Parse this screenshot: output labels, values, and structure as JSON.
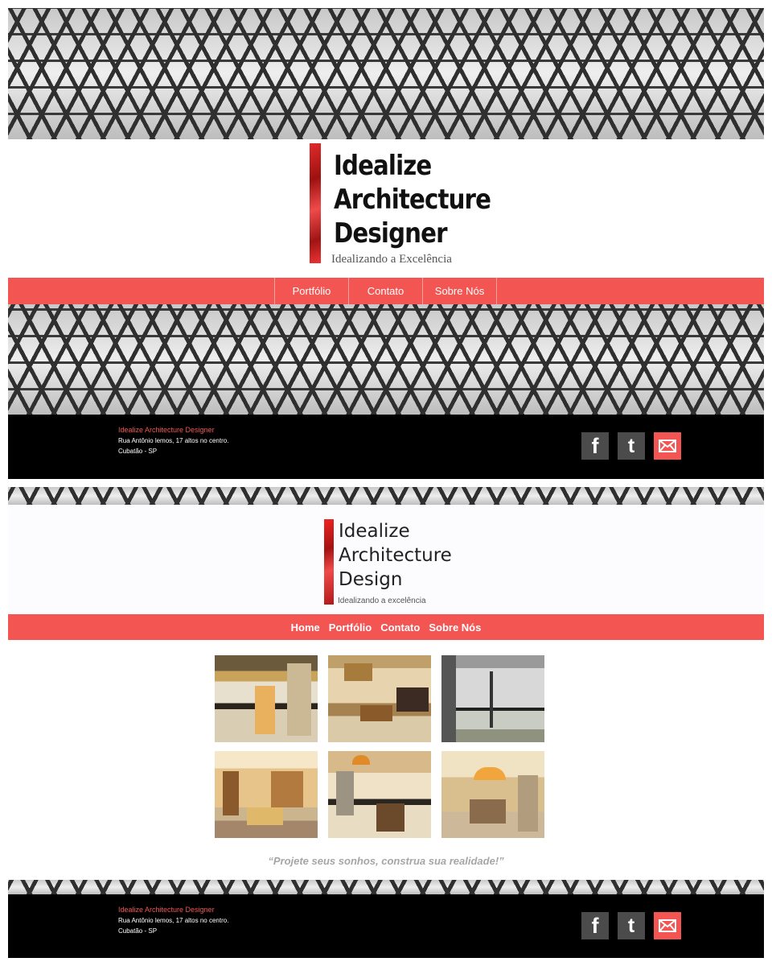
{
  "screen1": {
    "logo": {
      "line1": "Idealize",
      "line2": "Architecture",
      "line3": "Designer",
      "tagline": "Idealizando a Excelência"
    },
    "nav": [
      "Portfólio",
      "Contato",
      "Sobre Nós"
    ]
  },
  "screen2": {
    "logo": {
      "line1": "Idealize",
      "line2": "Architecture",
      "line3": "Design",
      "tagline": "Idealizando a excelência"
    },
    "nav": [
      "Home",
      "Portfólio",
      "Contato",
      "Sobre Nós"
    ],
    "gallery": [
      "kitchen-render",
      "living-room-render",
      "glass-hall-render",
      "tv-room-render",
      "kitchen-dining-render",
      "dining-room-render"
    ],
    "quote": "“Projete seus sonhos, construa sua realidade!”"
  },
  "footer": {
    "company": "Idealize Architecture Designer",
    "address": "Rua Antônio lemos, 17 altos no centro.",
    "city": "Cubatão  - SP"
  },
  "social": {
    "facebook_glyph": "f",
    "twitter_glyph": "t",
    "icons": [
      "facebook-icon",
      "twitter-icon",
      "email-icon"
    ]
  },
  "colors": {
    "accent": "#f25552",
    "footer_bg": "#000000"
  }
}
